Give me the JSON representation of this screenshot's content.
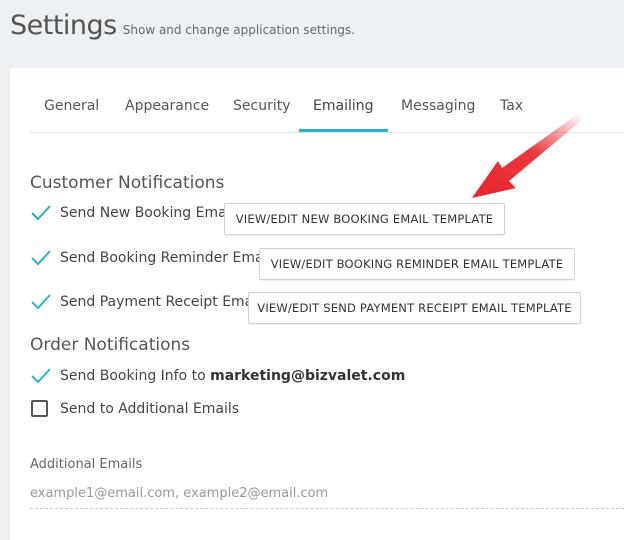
{
  "header": {
    "title": "Settings",
    "subtitle": "Show and change application settings."
  },
  "tabs": [
    {
      "label": "General",
      "active": false
    },
    {
      "label": "Appearance",
      "active": false
    },
    {
      "label": "Security",
      "active": false
    },
    {
      "label": "Emailing",
      "active": true
    },
    {
      "label": "Messaging",
      "active": false
    },
    {
      "label": "Tax",
      "active": false
    }
  ],
  "customer_notifications": {
    "title": "Customer Notifications",
    "items": [
      {
        "label": "Send New Booking Email",
        "checked": true,
        "button": "VIEW/EDIT NEW BOOKING EMAIL TEMPLATE"
      },
      {
        "label": "Send Booking Reminder Email",
        "checked": true,
        "button": "VIEW/EDIT BOOKING REMINDER EMAIL TEMPLATE"
      },
      {
        "label": "Send Payment Receipt Email",
        "checked": true,
        "button": "VIEW/EDIT SEND PAYMENT RECEIPT EMAIL TEMPLATE"
      }
    ]
  },
  "order_notifications": {
    "title": "Order Notifications",
    "booking_info": {
      "label": "Send Booking Info to ",
      "email": "marketing@bizvalet.com",
      "checked": true
    },
    "additional": {
      "label": "Send to Additional Emails",
      "checked": false
    }
  },
  "additional_emails": {
    "label": "Additional Emails",
    "value": "",
    "placeholder": "example1@email.com, example2@email.com"
  },
  "colors": {
    "accent": "#27b3c9",
    "check": "#2bb3c7",
    "arrow": "#e8232a"
  },
  "icons": {
    "check": "check-icon",
    "checkbox": "checkbox-empty-icon",
    "annotation": "red-arrow-icon"
  }
}
